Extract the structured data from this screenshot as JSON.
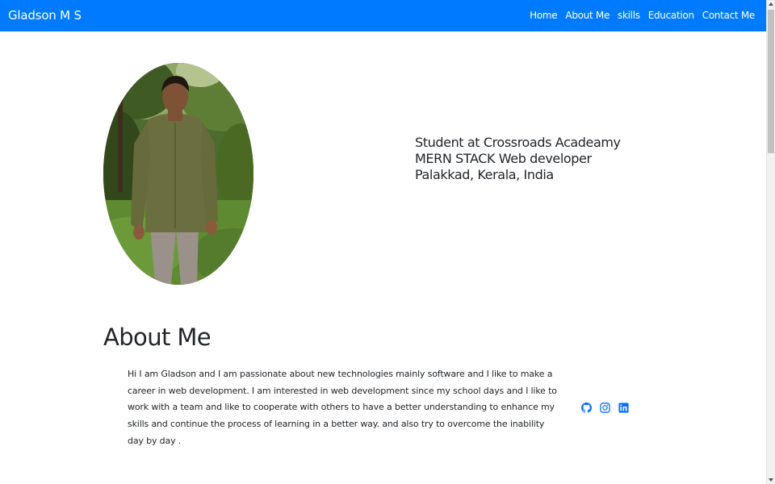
{
  "navbar": {
    "brand": "Gladson M S",
    "links": [
      "Home",
      "About Me",
      "skills",
      "Education",
      "Contact Me"
    ],
    "color": "#007bff"
  },
  "hero": {
    "lines": [
      "Student at Crossroads Acadeamy",
      "MERN STACK Web developer",
      "Palakkad, Kerala, India"
    ]
  },
  "about": {
    "heading": "About Me",
    "body": "Hi I am Gladson and I am passionate about new technologies mainly software and I like to make a career in web development. I am interested in web development since my school days and I like to work with a team and like to cooperate with others to have a better understanding to enhance my skills and continue the process of learning in a better way. and also try to overcome the inability day by day .",
    "socials": [
      "github-icon",
      "instagram-icon",
      "linkedin-icon"
    ]
  }
}
